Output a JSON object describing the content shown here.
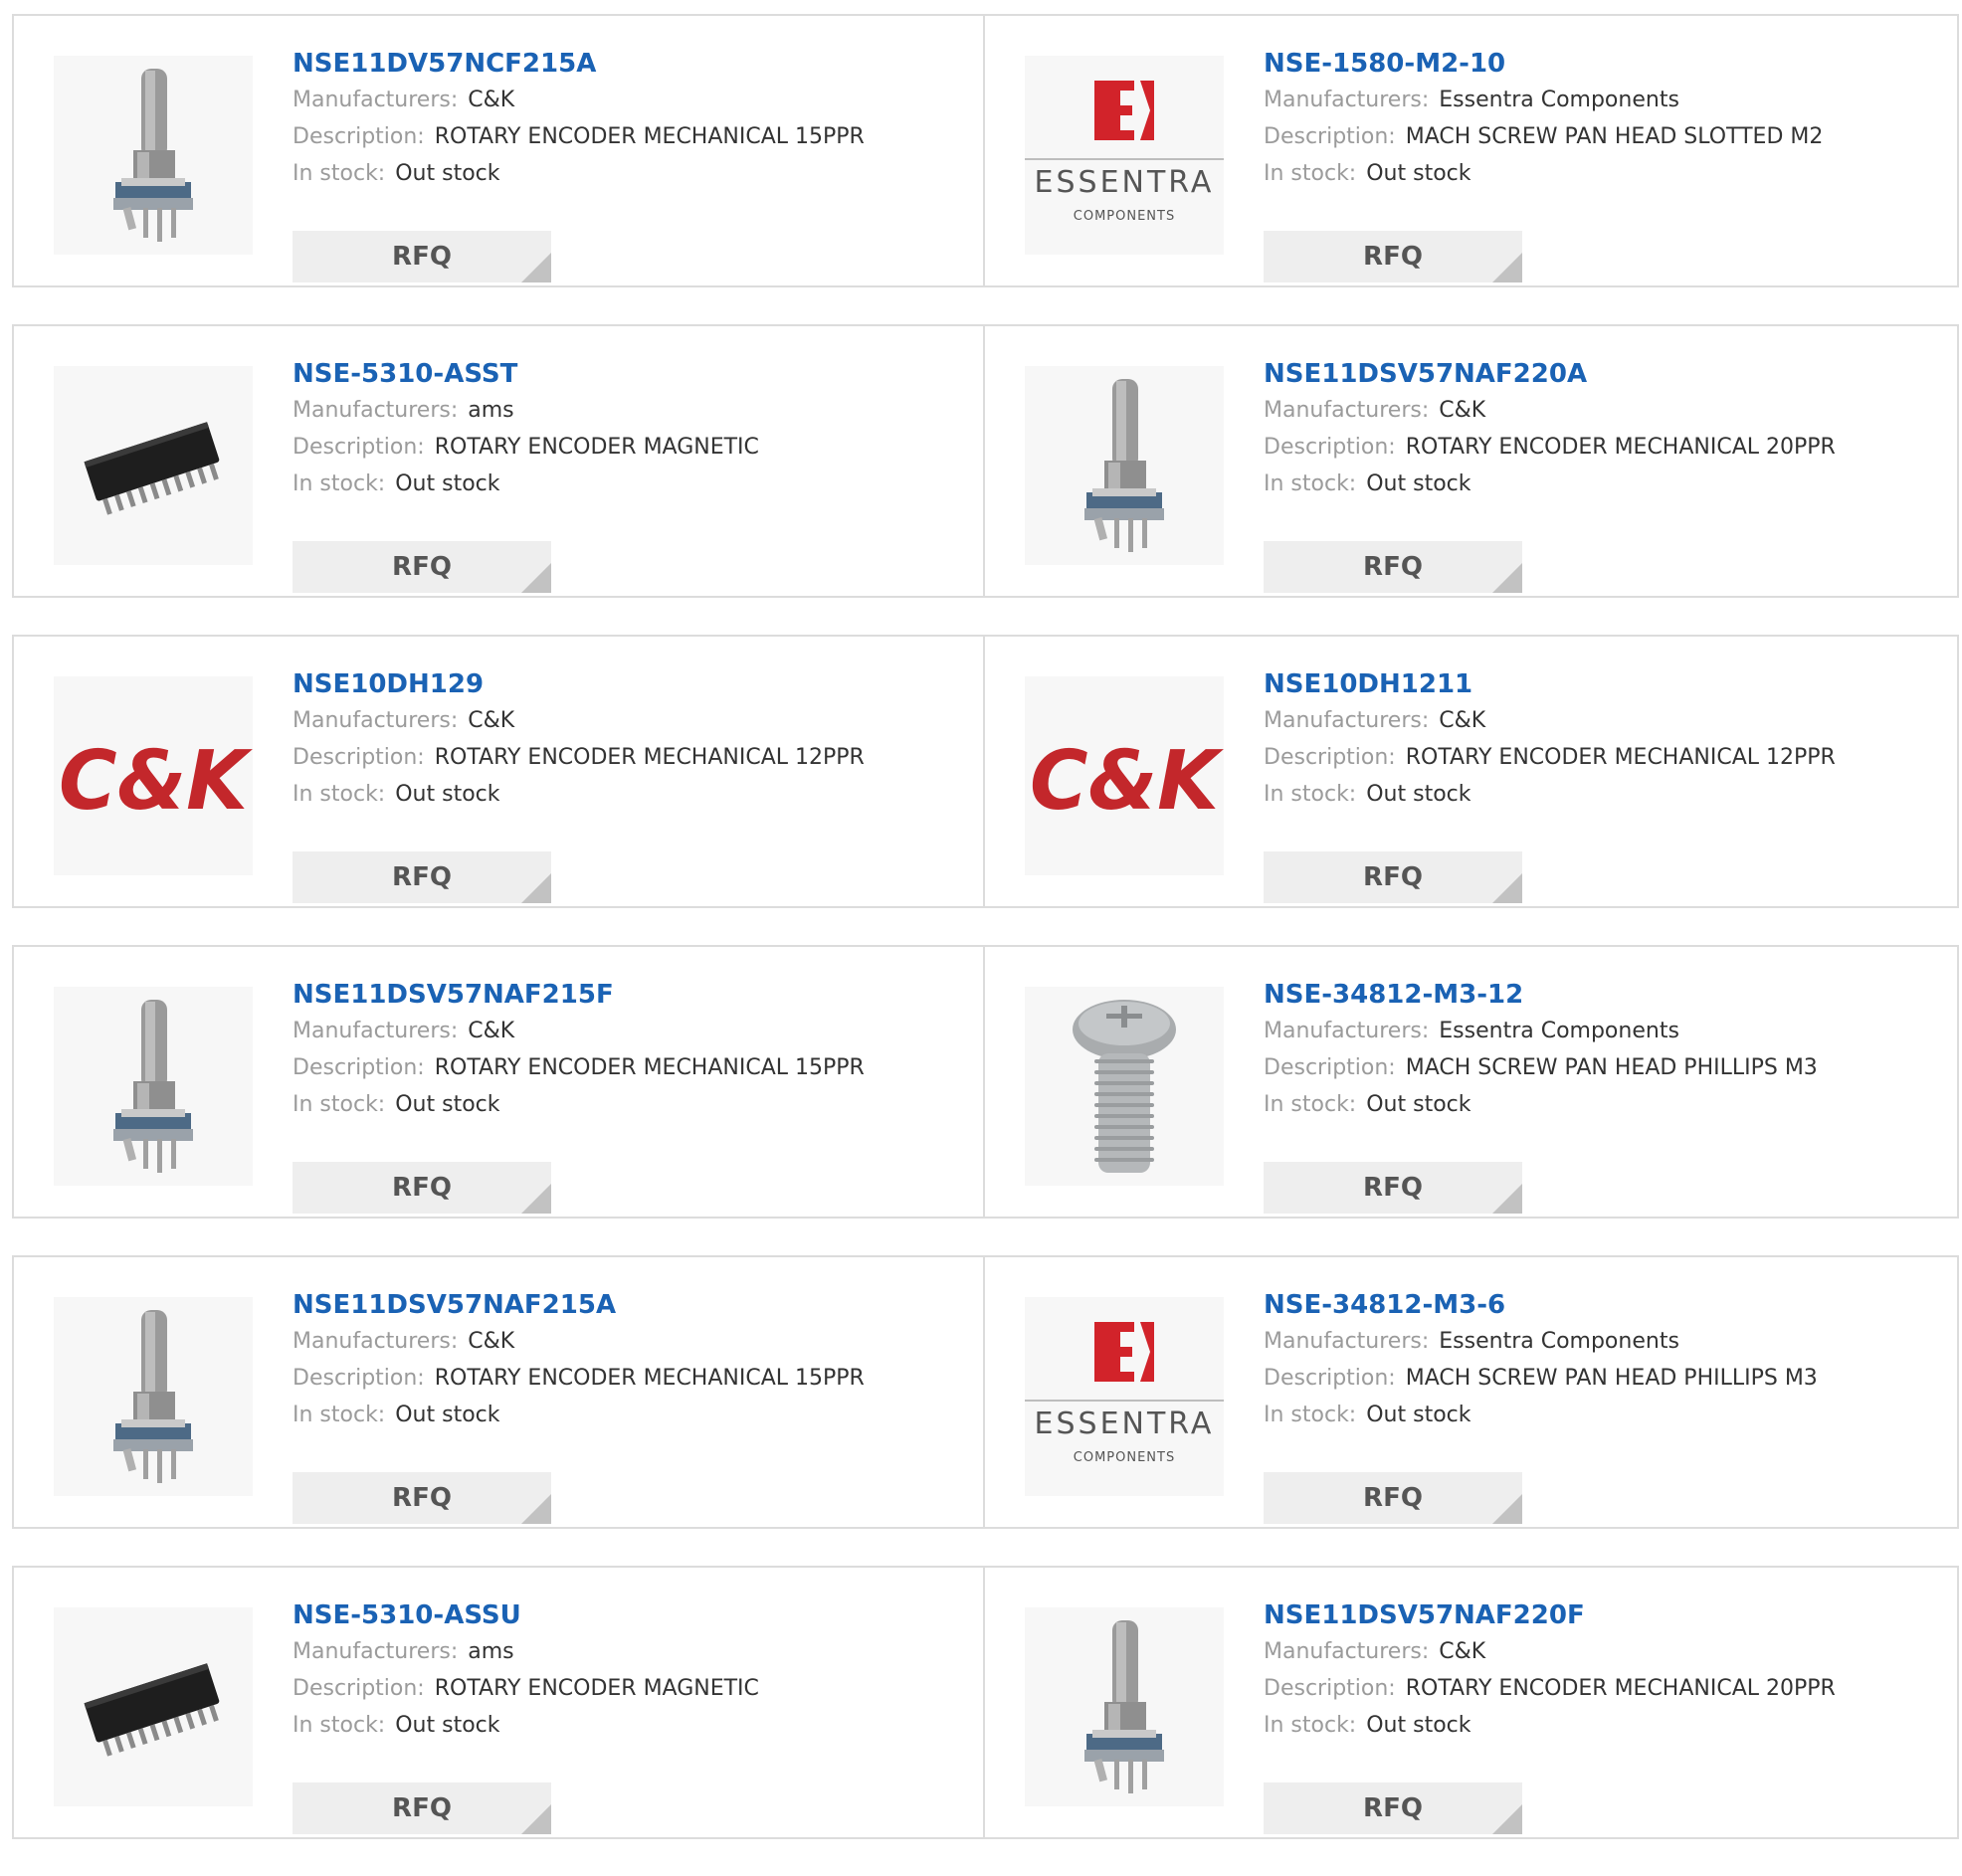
{
  "labels": {
    "manufacturers": "Manufacturers:",
    "description": "Description:",
    "in_stock": "In stock:",
    "rfq": "RFQ"
  },
  "products": [
    {
      "part": "NSE11DV57NCF215A",
      "manufacturer": "C&K",
      "description": "ROTARY ENCODER MECHANICAL 15PPR",
      "stock": "Out stock",
      "image": "rotary-encoder-image"
    },
    {
      "part": "NSE-1580-M2-10",
      "manufacturer": "Essentra Components",
      "description": "MACH SCREW PAN HEAD SLOTTED M2",
      "stock": "Out stock",
      "image": "essentra-logo",
      "logo_text": "ESSENTRA",
      "logo_sub": "COMPONENTS"
    },
    {
      "part": "NSE-5310-ASST",
      "manufacturer": "ams",
      "description": "ROTARY ENCODER MAGNETIC",
      "stock": "Out stock",
      "image": "ic-chip-image"
    },
    {
      "part": "NSE11DSV57NAF220A",
      "manufacturer": "C&K",
      "description": "ROTARY ENCODER MECHANICAL 20PPR",
      "stock": "Out stock",
      "image": "rotary-encoder-image"
    },
    {
      "part": "NSE10DH129",
      "manufacturer": "C&K",
      "description": "ROTARY ENCODER MECHANICAL 12PPR",
      "stock": "Out stock",
      "image": "ck-logo",
      "logo_text": "C&K"
    },
    {
      "part": "NSE10DH1211",
      "manufacturer": "C&K",
      "description": "ROTARY ENCODER MECHANICAL 12PPR",
      "stock": "Out stock",
      "image": "ck-logo",
      "logo_text": "C&K"
    },
    {
      "part": "NSE11DSV57NAF215F",
      "manufacturer": "C&K",
      "description": "ROTARY ENCODER MECHANICAL 15PPR",
      "stock": "Out stock",
      "image": "rotary-encoder-image"
    },
    {
      "part": "NSE-34812-M3-12",
      "manufacturer": "Essentra Components",
      "description": "MACH SCREW PAN HEAD PHILLIPS M3",
      "stock": "Out stock",
      "image": "screw-image"
    },
    {
      "part": "NSE11DSV57NAF215A",
      "manufacturer": "C&K",
      "description": "ROTARY ENCODER MECHANICAL 15PPR",
      "stock": "Out stock",
      "image": "rotary-encoder-image"
    },
    {
      "part": "NSE-34812-M3-6",
      "manufacturer": "Essentra Components",
      "description": "MACH SCREW PAN HEAD PHILLIPS M3",
      "stock": "Out stock",
      "image": "essentra-logo",
      "logo_text": "ESSENTRA",
      "logo_sub": "COMPONENTS"
    },
    {
      "part": "NSE-5310-ASSU",
      "manufacturer": "ams",
      "description": "ROTARY ENCODER MAGNETIC",
      "stock": "Out stock",
      "image": "ic-chip-image"
    },
    {
      "part": "NSE11DSV57NAF220F",
      "manufacturer": "C&K",
      "description": "ROTARY ENCODER MECHANICAL 20PPR",
      "stock": "Out stock",
      "image": "rotary-encoder-image"
    }
  ],
  "colors": {
    "link": "#1a62b4",
    "label": "#9b9b9b",
    "border": "#dcdcdc",
    "button_bg": "#eeeeee",
    "ck_red": "#c3272b",
    "essentra_red": "#d2232a"
  }
}
